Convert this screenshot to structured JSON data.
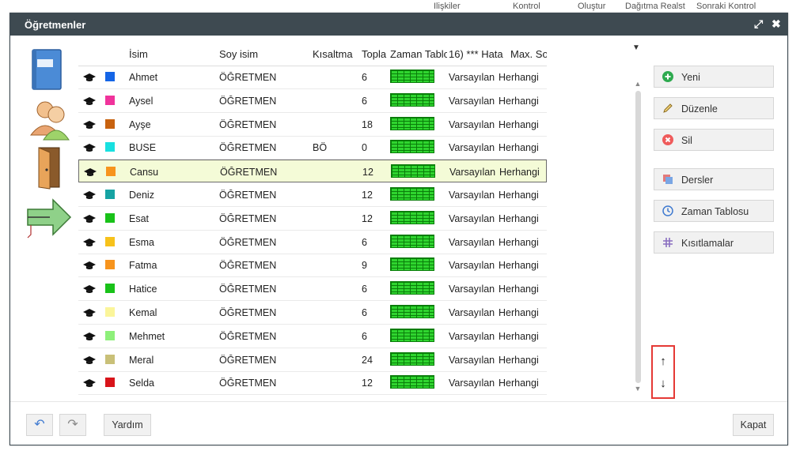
{
  "background": {
    "fragments": [
      "Ilişkiler",
      "Kontrol",
      "Oluştur",
      "Dağıtma Realst",
      "Sonraki Kontrol"
    ]
  },
  "dialog": {
    "title": "Öğretmenler",
    "maximize_glyph": "⤢",
    "close_glyph": "✖"
  },
  "side_nav": [
    {
      "icon": "notebook-icon"
    },
    {
      "icon": "teachers-icon"
    },
    {
      "icon": "door-icon"
    },
    {
      "icon": "arrow-right-icon"
    }
  ],
  "table": {
    "columns": [
      "İsim",
      "Soy isim",
      "Kısaltma",
      "Toplam",
      "Zaman Tablosu",
      "16) *** Hata",
      "Max. Sonuç"
    ],
    "column_dropdown_glyph": "▼",
    "rows": [
      {
        "name": "Ahmet",
        "surname": "ÖĞRETMEN",
        "abbr": "",
        "total": "6",
        "c16": "Varsayılan",
        "max": "Herhangi",
        "color": "#1565e6"
      },
      {
        "name": "Aysel",
        "surname": "ÖĞRETMEN",
        "abbr": "",
        "total": "6",
        "c16": "Varsayılan",
        "max": "Herhangi",
        "color": "#f0339b"
      },
      {
        "name": "Ayşe",
        "surname": "ÖĞRETMEN",
        "abbr": "",
        "total": "18",
        "c16": "Varsayılan",
        "max": "Herhangi",
        "color": "#c8620f"
      },
      {
        "name": "BUSE",
        "surname": "ÖĞRETMEN",
        "abbr": "BÖ",
        "total": "0",
        "c16": "Varsayılan",
        "max": "Herhangi",
        "color": "#18e0e0"
      },
      {
        "name": "Cansu",
        "surname": "ÖĞRETMEN",
        "abbr": "",
        "total": "12",
        "c16": "Varsayılan",
        "max": "Herhangi",
        "color": "#f7941d"
      },
      {
        "name": "Deniz",
        "surname": "ÖĞRETMEN",
        "abbr": "",
        "total": "12",
        "c16": "Varsayılan",
        "max": "Herhangi",
        "color": "#16a3a3"
      },
      {
        "name": "Esat",
        "surname": "ÖĞRETMEN",
        "abbr": "",
        "total": "12",
        "c16": "Varsayılan",
        "max": "Herhangi",
        "color": "#19c219"
      },
      {
        "name": "Esma",
        "surname": "ÖĞRETMEN",
        "abbr": "",
        "total": "6",
        "c16": "Varsayılan",
        "max": "Herhangi",
        "color": "#f7c21b"
      },
      {
        "name": "Fatma",
        "surname": "ÖĞRETMEN",
        "abbr": "",
        "total": "9",
        "c16": "Varsayılan",
        "max": "Herhangi",
        "color": "#f7941d"
      },
      {
        "name": "Hatice",
        "surname": "ÖĞRETMEN",
        "abbr": "",
        "total": "6",
        "c16": "Varsayılan",
        "max": "Herhangi",
        "color": "#19c219"
      },
      {
        "name": "Kemal",
        "surname": "ÖĞRETMEN",
        "abbr": "",
        "total": "6",
        "c16": "Varsayılan",
        "max": "Herhangi",
        "color": "#fbf59a"
      },
      {
        "name": "Mehmet",
        "surname": "ÖĞRETMEN",
        "abbr": "",
        "total": "6",
        "c16": "Varsayılan",
        "max": "Herhangi",
        "color": "#8ef07a"
      },
      {
        "name": "Meral",
        "surname": "ÖĞRETMEN",
        "abbr": "",
        "total": "24",
        "c16": "Varsayılan",
        "max": "Herhangi",
        "color": "#c9c078"
      },
      {
        "name": "Selda",
        "surname": "ÖĞRETMEN",
        "abbr": "",
        "total": "12",
        "c16": "Varsayılan",
        "max": "Herhangi",
        "color": "#d8141a"
      }
    ],
    "selected_index": 4
  },
  "actions": {
    "new": "Yeni",
    "edit": "Düzenle",
    "delete": "Sil",
    "lessons": "Dersler",
    "timetable": "Zaman Tablosu",
    "constraints": "Kısıtlamalar"
  },
  "move": {
    "up": "↑",
    "down": "↓"
  },
  "footer": {
    "undo": "↶",
    "redo": "↷",
    "help": "Yardım",
    "close": "Kapat"
  },
  "colors": {
    "titlebar": "#3e4a51",
    "selected_row": "#f4fbd7",
    "highlight_box": "#e53935",
    "grid_fill": "#2fd52f"
  }
}
